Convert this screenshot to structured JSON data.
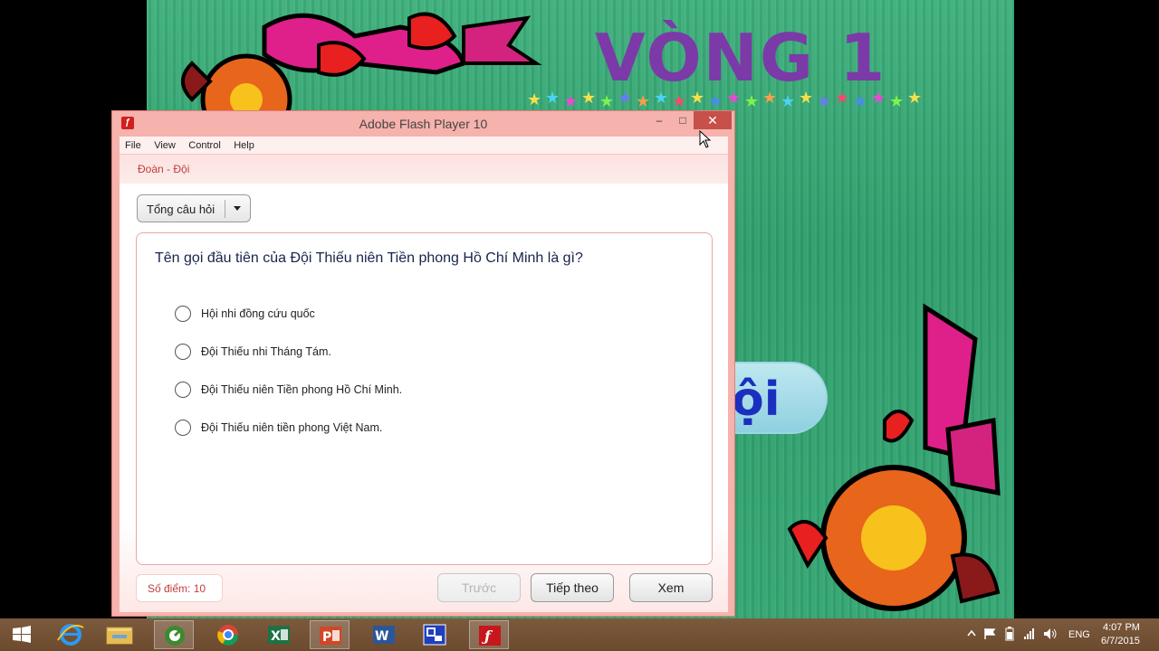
{
  "background": {
    "title": "VÒNG 1",
    "bubble_text": "ội"
  },
  "window": {
    "title": "Adobe Flash Player 10",
    "controls": {
      "minimize": "–",
      "maximize": "□",
      "close": "✕"
    },
    "menu": [
      "File",
      "View",
      "Control",
      "Help"
    ]
  },
  "quiz": {
    "breadcrumb": "Đoàn - Đội",
    "dropdown_label": "Tổng câu hỏi",
    "question": "Tên gọi đầu tiên của Đội Thiếu niên Tiền phong Hồ Chí Minh là gì?",
    "options": [
      "Hội nhi đồng cứu quốc",
      "Đội Thiếu nhi Tháng Tám.",
      "Đội Thiếu niên Tiền phong Hồ Chí Minh.",
      "Đội Thiếu niên tiền phong Việt Nam."
    ],
    "score": "Số điểm: 10",
    "buttons": {
      "prev": "Trước",
      "next": "Tiếp theo",
      "view": "Xem"
    }
  },
  "taskbar": {
    "apps": [
      "start-icon",
      "internet-explorer-icon",
      "file-explorer-icon",
      "camtasia-icon",
      "chrome-icon",
      "excel-icon",
      "powerpoint-icon",
      "word-icon",
      "app-icon",
      "flash-player-icon"
    ],
    "language": "ENG",
    "time": "4:07 PM",
    "date": "6/7/2015"
  },
  "colors": {
    "window_frame": "#f6b2ac",
    "accent_red": "#c23d3d",
    "slide_green": "#35a673",
    "title_purple": "#7b3aa8",
    "taskbar": "#6c4a2e"
  }
}
